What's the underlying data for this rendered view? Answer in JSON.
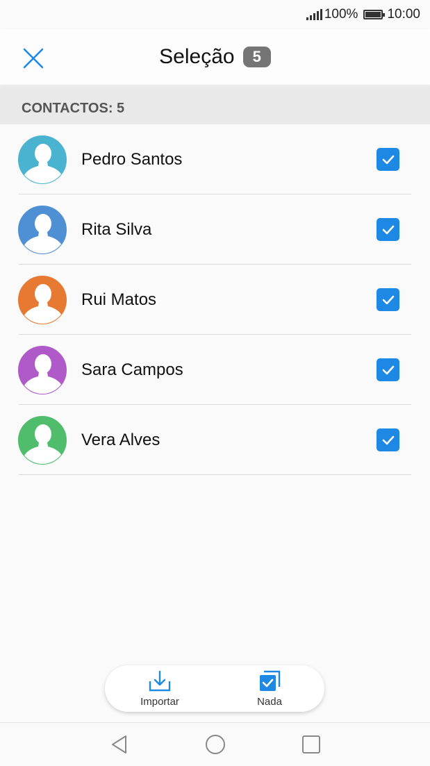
{
  "status_bar": {
    "battery_percent": "100%",
    "time": "10:00"
  },
  "header": {
    "title": "Seleção",
    "count": "5"
  },
  "section": {
    "label": "CONTACTOS: 5"
  },
  "contacts": [
    {
      "name": "Pedro Santos",
      "color": "#4ab3cf",
      "checked": true
    },
    {
      "name": "Rita Silva",
      "color": "#4f8fd4",
      "checked": true
    },
    {
      "name": "Rui Matos",
      "color": "#e77a32",
      "checked": true
    },
    {
      "name": "Sara Campos",
      "color": "#b05ac9",
      "checked": true
    },
    {
      "name": "Vera Alves",
      "color": "#50bd6d",
      "checked": true
    }
  ],
  "actions": {
    "import_label": "Importar",
    "none_label": "Nada"
  },
  "colors": {
    "accent": "#1e88e5",
    "badge": "#757575"
  },
  "icons": {
    "close": "close-icon",
    "import": "import-icon",
    "select_none": "select-none-icon",
    "back": "back-icon",
    "home": "home-icon",
    "recents": "recents-icon"
  }
}
